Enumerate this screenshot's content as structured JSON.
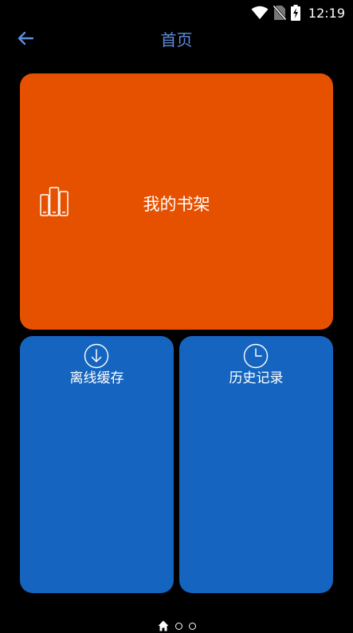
{
  "status_bar": {
    "time": "12:19",
    "icons": [
      "wifi-icon",
      "no-sim-icon",
      "battery-charging-icon"
    ]
  },
  "app_bar": {
    "title": "首页",
    "back_icon": "arrow-left-icon"
  },
  "tiles": [
    {
      "label": "我的书架",
      "icon": "bookshelf-icon",
      "color": "#e65100"
    },
    {
      "label": "离线缓存",
      "icon": "download-circle-icon",
      "color": "#1565c0"
    },
    {
      "label": "历史记录",
      "icon": "clock-icon",
      "color": "#1565c0"
    }
  ],
  "pager": {
    "icons": [
      "home-icon",
      "page-dot-icon",
      "page-dot-icon"
    ],
    "active_index": 0
  },
  "colors": {
    "background": "#000000",
    "accent": "#5e8ddc"
  }
}
